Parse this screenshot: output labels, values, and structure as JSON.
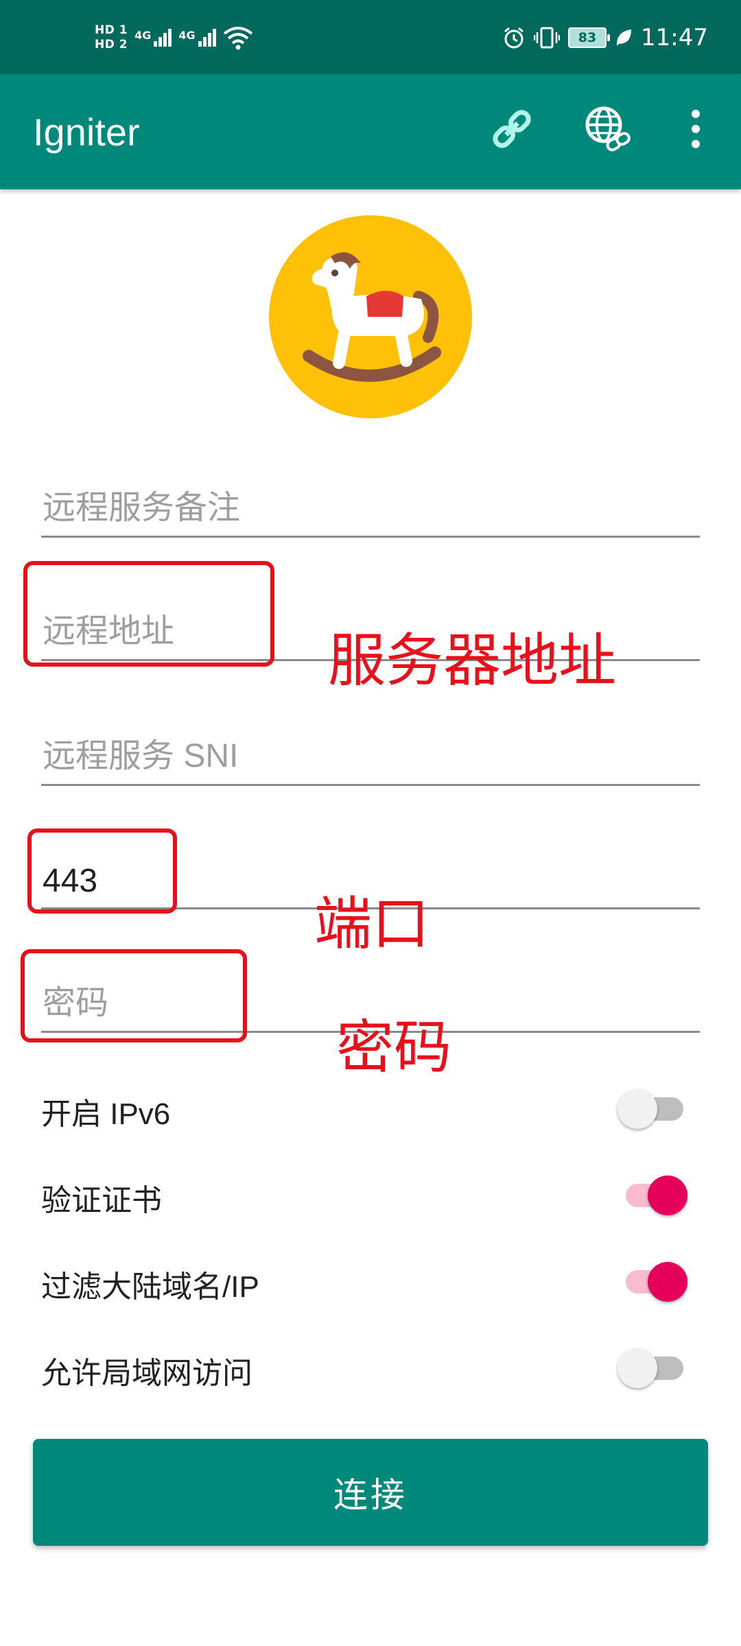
{
  "status_bar": {
    "hd1": "HD 1",
    "hd2": "HD 2",
    "sim1_label": "4G",
    "sim2_label": "4G",
    "battery": "83",
    "time": "11:47"
  },
  "app_bar": {
    "title": "Igniter",
    "actions": [
      "link-icon",
      "globe-link-icon",
      "overflow-menu-icon"
    ]
  },
  "logo_icon": "rocking-horse-icon",
  "form": {
    "remark": {
      "placeholder": "远程服务备注",
      "value": ""
    },
    "address": {
      "placeholder": "远程地址",
      "value": ""
    },
    "sni": {
      "placeholder": "远程服务 SNI",
      "value": ""
    },
    "port": {
      "placeholder": "",
      "value": "443"
    },
    "password": {
      "placeholder": "密码",
      "value": ""
    }
  },
  "toggles": [
    {
      "label": "开启 IPv6",
      "on": false
    },
    {
      "label": "验证证书",
      "on": true
    },
    {
      "label": "过滤大陆域名/IP",
      "on": true
    },
    {
      "label": "允许局域网访问",
      "on": false
    }
  ],
  "connect_label": "连接",
  "annotations": {
    "address": "服务器地址",
    "port": "端口",
    "password": "密码"
  },
  "colors": {
    "status_bar": "#00695c",
    "primary": "#00897b",
    "accent": "#e5005a",
    "logo_bg": "#ffc107",
    "annotation": "#e8101a"
  }
}
